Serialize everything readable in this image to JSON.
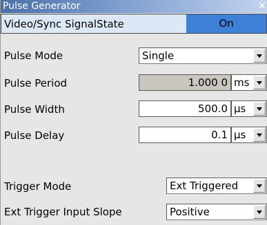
{
  "window": {
    "title": "Pulse Generator",
    "close_glyph": "✕"
  },
  "signal_state": {
    "label": "Video/Sync SignalState",
    "value": "On"
  },
  "pulse_mode": {
    "label": "Pulse Mode",
    "value": "Single"
  },
  "pulse_period": {
    "label": "Pulse Period",
    "value": "1.000 0",
    "unit": "ms"
  },
  "pulse_width": {
    "label": "Pulse Width",
    "value": "500.0",
    "unit": "µs"
  },
  "pulse_delay": {
    "label": "Pulse Delay",
    "value": "0.1",
    "unit": "µs"
  },
  "trigger_mode": {
    "label": "Trigger Mode",
    "value": "Ext Triggered"
  },
  "ext_trigger_slope": {
    "label": "Ext Trigger Input Slope",
    "value": "Positive"
  },
  "colors": {
    "state_on": "#3d80d8",
    "title_start": "#4a6fa8",
    "disabled_field": "#c9c6c0"
  }
}
